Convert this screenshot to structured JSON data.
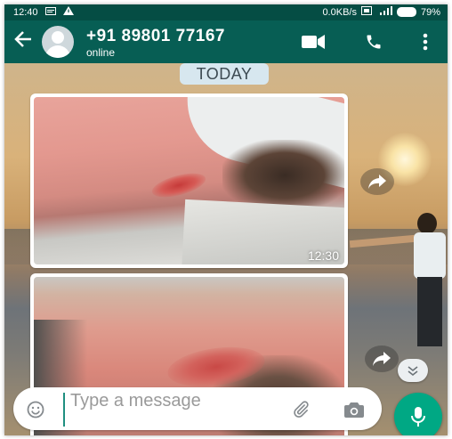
{
  "status_bar": {
    "time": "12:40",
    "net_speed": "0.0KB/s",
    "battery_percent": "79%"
  },
  "header": {
    "contact_name": "+91 89801 77167",
    "contact_status": "online",
    "icons": [
      "back-arrow-icon",
      "avatar",
      "video-call-icon",
      "phone-icon",
      "more-vert-icon"
    ]
  },
  "chat": {
    "date_chip": "TODAY",
    "messages": [
      {
        "type": "image",
        "time": "12:30"
      },
      {
        "type": "image",
        "time": ""
      }
    ]
  },
  "compose": {
    "placeholder": "Type a message",
    "icons": [
      "emoji-icon",
      "attach-icon",
      "camera-icon",
      "mic-icon"
    ]
  },
  "colors": {
    "header": "#075e54",
    "status_bar": "#054d44",
    "accent": "#00a884",
    "date_chip": "#d7e7ef"
  }
}
